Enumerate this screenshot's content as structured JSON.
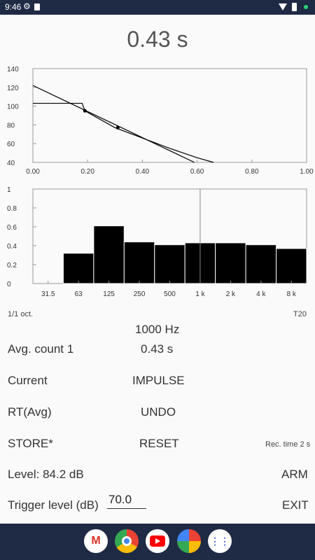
{
  "status": {
    "time": "9:46"
  },
  "result": {
    "main_rt": "0.43 s"
  },
  "decay_chart": {
    "y_ticks": [
      "140",
      "120",
      "100",
      "80",
      "60",
      "40"
    ],
    "x_ticks": [
      "0.00",
      "0.20",
      "0.40",
      "0.60",
      "0.80",
      "1.00"
    ]
  },
  "spectrum_chart": {
    "y_ticks": [
      "1",
      "0.8",
      "0.6",
      "0.4",
      "0.2",
      "0"
    ],
    "x_ticks": [
      "31.5",
      "63",
      "125",
      "250",
      "500",
      "1 k",
      "2 k",
      "4 k",
      "8 k"
    ]
  },
  "chart_data": [
    {
      "type": "line",
      "xlim": [
        0,
        1.0
      ],
      "ylim": [
        40,
        140
      ],
      "grid": false,
      "series": [
        {
          "x": [
            0.0,
            0.18,
            0.19,
            0.3,
            0.4,
            0.5,
            0.6,
            0.66
          ],
          "y": [
            103,
            103,
            95,
            77,
            66,
            55,
            45,
            40
          ]
        },
        {
          "x": [
            0.0,
            0.59
          ],
          "y": [
            122,
            40
          ]
        }
      ],
      "markers": [
        {
          "x": 0.19,
          "y": 95
        },
        {
          "x": 0.31,
          "y": 77
        }
      ]
    },
    {
      "type": "bar",
      "categories": [
        "31.5",
        "63",
        "125",
        "250",
        "500",
        "1 k",
        "2 k",
        "4 k",
        "8 k"
      ],
      "values": [
        0,
        0.32,
        0.61,
        0.44,
        0.41,
        0.43,
        0.43,
        0.41,
        0.37
      ],
      "ylim": [
        0,
        1
      ],
      "cursor_category": "1 k"
    }
  ],
  "info": {
    "band_mode": "1/1 oct.",
    "rt_type": "T20",
    "frequency": "1000 Hz",
    "avg_count": "Avg. count 1",
    "value_rt": "0.43 s",
    "rec_time": "Rec. time 2 s",
    "level": "Level: 84.2 dB"
  },
  "controls": {
    "current": "Current",
    "impulse": "IMPULSE",
    "rt_avg": "RT(Avg)",
    "undo": "UNDO",
    "store": "STORE*",
    "reset": "RESET",
    "arm": "ARM",
    "trigger_label": "Trigger level (dB)",
    "trigger_value": "70.0",
    "exit": "EXIT"
  },
  "dock": {
    "apps": [
      "gmail-icon",
      "chrome-icon",
      "youtube-icon",
      "photos-icon",
      "app-drawer-icon"
    ],
    "colors": {
      "bar": "#1f2a44",
      "gmail": "#d93025",
      "youtube": "#ff0000"
    }
  }
}
